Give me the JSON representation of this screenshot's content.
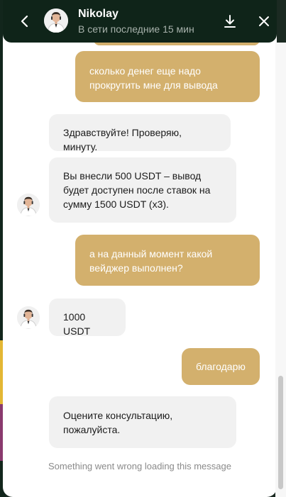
{
  "header": {
    "agent_name": "Nikolay",
    "status": "В сети последние 15 мин"
  },
  "icons": {
    "back": "chevron-left-icon",
    "download": "download-icon",
    "close": "close-icon",
    "avatar": "agent-avatar"
  },
  "colors": {
    "header_bg": "#0f2419",
    "outgoing_bubble": "#d3b06d",
    "incoming_bubble": "#f1f1f1"
  },
  "messages": [
    {
      "from": "user",
      "text": "сколько денег еще надо прокрутить мне для вывода"
    },
    {
      "from": "agent",
      "text": "Здравствуйте! Проверяю, минуту."
    },
    {
      "from": "agent",
      "text": "Вы внесли 500 USDT – вывод будет доступен после ставок на сумму 1500 USDT (x3)."
    },
    {
      "from": "user",
      "text": "а на данный момент какой вейджер выполнен?"
    },
    {
      "from": "agent",
      "text": "1000 USDT"
    },
    {
      "from": "user",
      "text": "благодарю"
    },
    {
      "from": "agent",
      "text": "Оцените консультацию, пожалуйста."
    }
  ],
  "error_note": "Something went wrong loading this message"
}
